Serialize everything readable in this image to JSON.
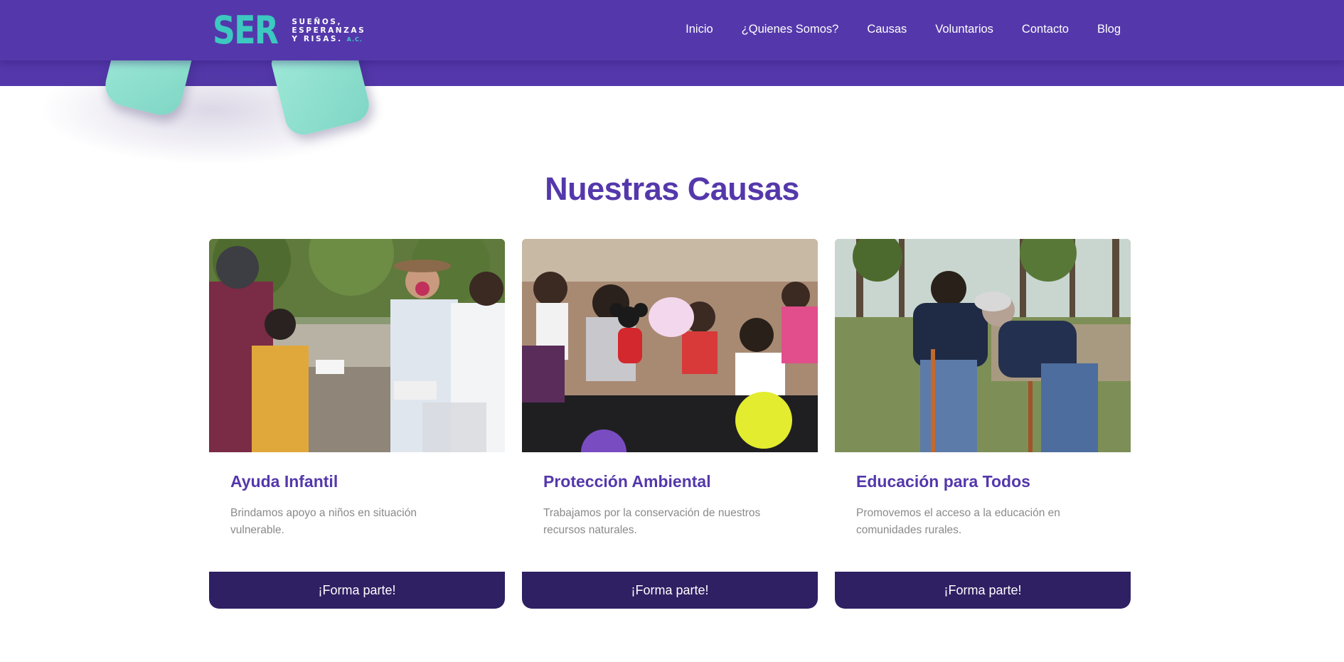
{
  "brand": {
    "logo_mark": "SER",
    "logo_lines": [
      "SUEÑOS,",
      "ESPERANZAS",
      "Y RISAS."
    ],
    "logo_suffix": "A.C.",
    "colors": {
      "primary": "#5438ab",
      "dark": "#2f1f63",
      "accent": "#3cc9c0",
      "mint": "#8fdfcd"
    }
  },
  "nav": {
    "items": [
      {
        "label": "Inicio"
      },
      {
        "label": "¿Quienes Somos?"
      },
      {
        "label": "Causas"
      },
      {
        "label": "Voluntarios"
      },
      {
        "label": "Contacto"
      },
      {
        "label": "Blog"
      }
    ]
  },
  "section": {
    "title": "Nuestras Causas"
  },
  "causes": [
    {
      "title": "Ayuda Infantil",
      "description": "Brindamos apoyo a niños en situación vulnerable.",
      "button_label": "¡Forma parte!",
      "image": "photo-volunteers-giving-aid"
    },
    {
      "title": "Protección Ambiental",
      "description": "Trabajamos por la conservación de nuestros recursos naturales.",
      "button_label": "¡Forma parte!",
      "image": "photo-children-with-balloons-and-toys"
    },
    {
      "title": "Educación para Todos",
      "description": "Promovemos el acceso a la educación en comunidades rurales.",
      "button_label": "¡Forma parte!",
      "image": "photo-men-planting-trees"
    }
  ]
}
